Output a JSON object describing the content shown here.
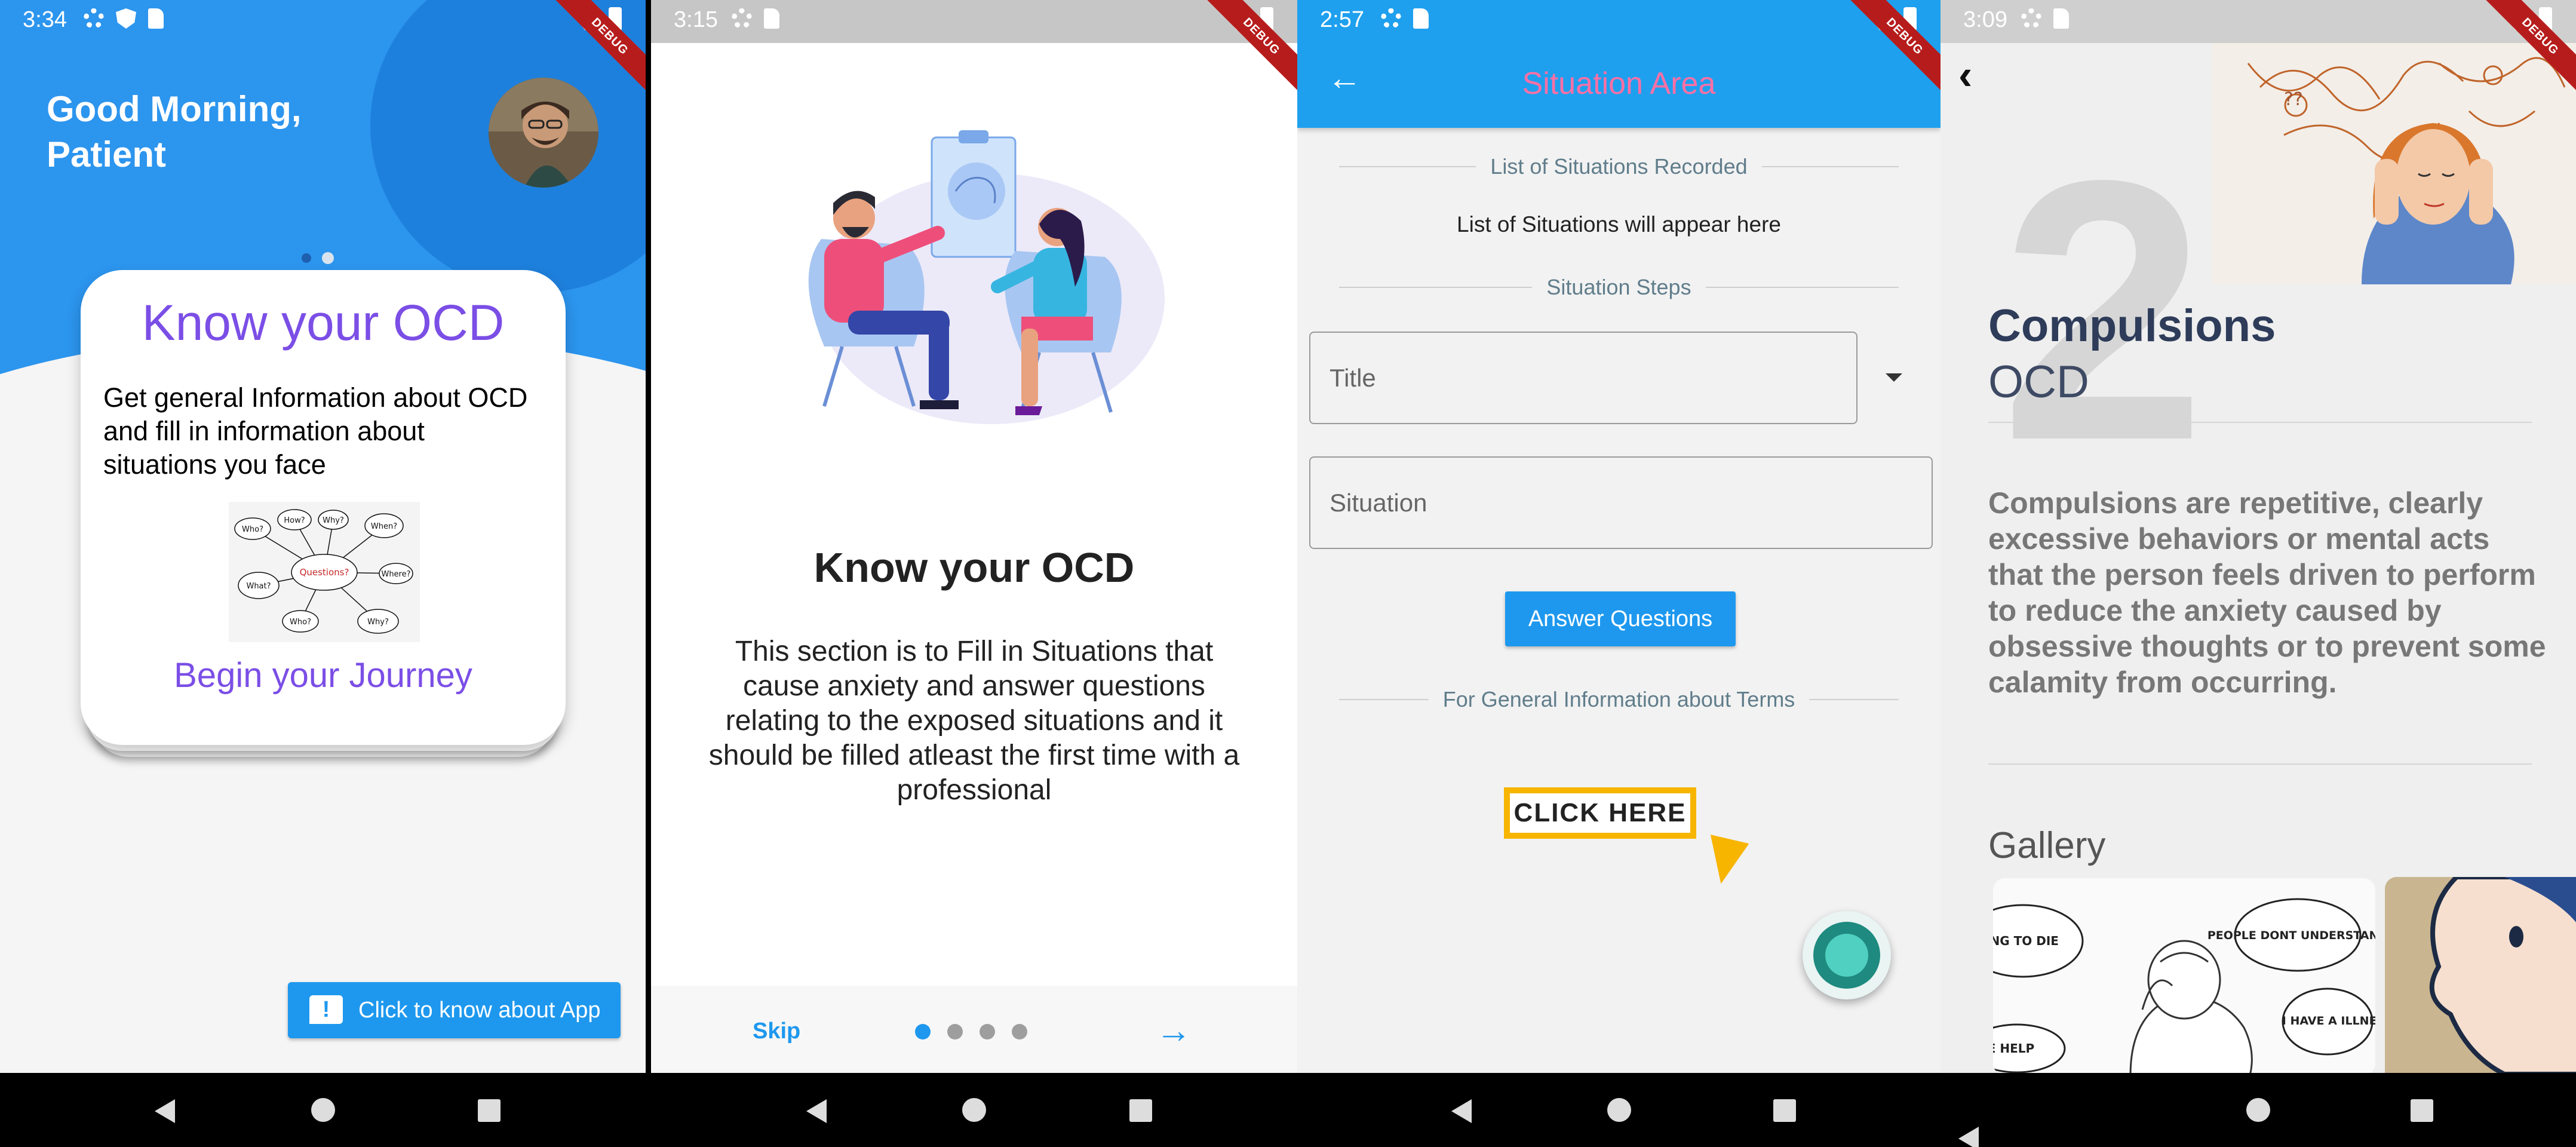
{
  "screen1": {
    "time": "3:34",
    "debug": "DEBUG",
    "greeting": "Good Morning,\nPatient",
    "card_title": "Know your OCD",
    "card_text": "Get general Information about OCD and fill in information about situations you face",
    "card_cta": "Begin your Journey",
    "image_words": [
      "Who?",
      "How?",
      "Why?",
      "When?",
      "What?",
      "Where?",
      "Questions?"
    ],
    "about_button": "Click to know about App",
    "about_icon": "!",
    "colors": {
      "primary": "#2c95ee",
      "accent": "#7b4ee6",
      "button": "#1e98ee"
    }
  },
  "screen2": {
    "time": "3:15",
    "debug": "DEBUG",
    "title": "Know your OCD",
    "text": "This section is to Fill in Situations that cause anxiety and answer questions relating to the exposed situations and it should be filled atleast the first time with a professional",
    "skip": "Skip",
    "next_icon": "→",
    "page_count": 4,
    "current_page": 1
  },
  "screen3": {
    "time": "2:57",
    "debug": "DEBUG",
    "back_icon": "←",
    "title": "Situation Area",
    "section_recorded": "List of Situations Recorded",
    "placeholder_list": "List of Situations will appear here",
    "section_steps": "Situation Steps",
    "field_title_placeholder": "Title",
    "field_situation_placeholder": "Situation",
    "answer_button": "Answer Questions",
    "section_terms": "For General Information about Terms",
    "click_here": "CLICK HERE"
  },
  "screen4": {
    "time": "3:09",
    "debug": "DEBUG",
    "back_icon": "‹",
    "number": "2",
    "title": "Compulsions",
    "subtitle": "OCD",
    "text": "Compulsions are repetitive, clearly excessive behaviors or mental acts that the person feels driven to perform to reduce the anxiety caused by obsessive thoughts or to prevent some calamity from occurring.",
    "gallery": "Gallery",
    "bubbles": [
      "OING TO DIE",
      "PEOPLE DONT UNDERSTAND",
      "I HAVE A ILLNES",
      "E HELP"
    ]
  }
}
